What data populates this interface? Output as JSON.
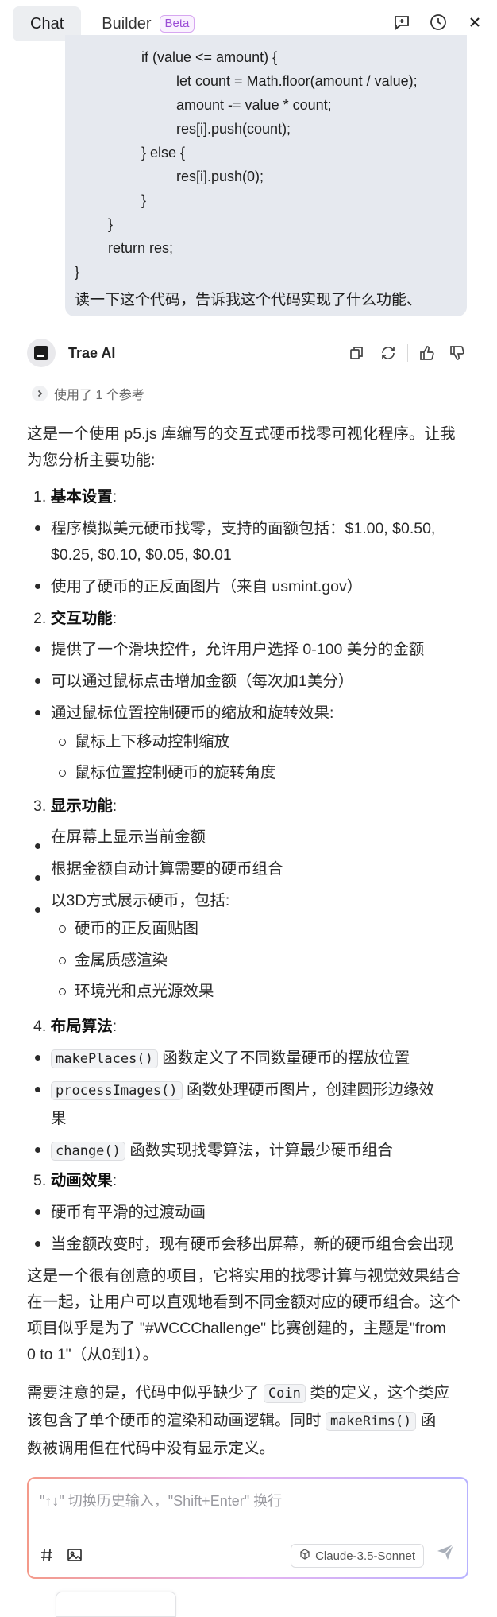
{
  "header": {
    "tabs": [
      {
        "label": "Chat"
      },
      {
        "label": "Builder"
      }
    ],
    "beta_label": "Beta",
    "icons": [
      "new-chat-icon",
      "history-icon",
      "close-icon"
    ]
  },
  "user_message": {
    "code_lines": [
      "if (value <= amount) {",
      "let count = Math.floor(amount / value);",
      "amount -= value * count;",
      "res[i].push(count);",
      "} else {",
      "res[i].push(0);",
      "}",
      "}",
      "return res;",
      "}"
    ],
    "prompt": "读一下这个代码，告诉我这个代码实现了什么功能、"
  },
  "assistant": {
    "name": "Trae AI",
    "reference": "使用了 1 个参考",
    "intro": [
      "这是一个使用 p5.js 库编写的交互式硬币找零可视化程序。让我",
      "为您分析主要功能:"
    ],
    "sections": [
      {
        "num": "1.",
        "title": "基本设置",
        "colon": ":",
        "items": [
          "程序模拟美元硬币找零，支持的面额包括：$1.00, $0.50,",
          "$0.25, $0.10, $0.05, $0.01",
          "使用了硬币的正反面图片（来自 usmint.gov）"
        ]
      },
      {
        "num": "2.",
        "title": "交互功能",
        "colon": ":",
        "items": [
          "提供了一个滑块控件，允许用户选择 0-100 美分的金额",
          "可以通过鼠标点击增加金额（每次加1美分）",
          "通过鼠标位置控制硬币的缩放和旋转效果:"
        ],
        "sub_items": [
          "鼠标上下移动控制缩放",
          "鼠标位置控制硬币的旋转角度"
        ]
      },
      {
        "num": "3.",
        "title": "显示功能",
        "colon": ":",
        "items": [
          "在屏幕上显示当前金额",
          "根据金额自动计算需要的硬币组合",
          "以3D方式展示硬币，包括:"
        ],
        "sub_items": [
          "硬币的正反面贴图",
          "金属质感渲染",
          "环境光和点光源效果"
        ]
      },
      {
        "num": "4.",
        "title": "布局算法",
        "colon": ":",
        "items": [
          {
            "code": "makePlaces()",
            "text": "函数定义了不同数量硬币的摆放位置"
          },
          {
            "code": "processImages()",
            "text": "函数处理硬币图片，创建圆形边缘效",
            "cont": "果"
          },
          {
            "code": "change()",
            "text": "函数实现找零算法，计算最少硬币组合"
          }
        ]
      },
      {
        "num": "5.",
        "title": "动画效果",
        "colon": ":",
        "items": [
          "硬币有平滑的过渡动画",
          "当金额改变时，现有硬币会移出屏幕，新的硬币组合会出现"
        ]
      }
    ],
    "closing": [
      "这是一个很有创意的项目，它将实用的找零计算与视觉效果结合",
      "在一起，让用户可以直观地看到不同金额对应的硬币组合。这个",
      "项目似乎是为了 \"#WCCChallenge\" 比赛创建的，主题是\"from",
      "0 to 1\"（从0到1）。"
    ],
    "note": {
      "l1_a": "需要注意的是，代码中似乎缺少了",
      "l1_code": "Coin",
      "l1_b": "类的定义，这个类应",
      "l2_a": "该包含了单个硬币的渲染和动画逻辑。同时",
      "l2_code": "makeRims()",
      "l2_b": "函",
      "l3": "数被调用但在代码中没有显示定义。"
    }
  },
  "composer": {
    "placeholder": "\"↑↓\" 切换历史输入，\"Shift+Enter\" 换行",
    "model": "Claude-3.5-Sonnet"
  },
  "colors": {
    "accent_beta": "#9b4dd6",
    "bubble_bg": "#e6e9ef"
  }
}
